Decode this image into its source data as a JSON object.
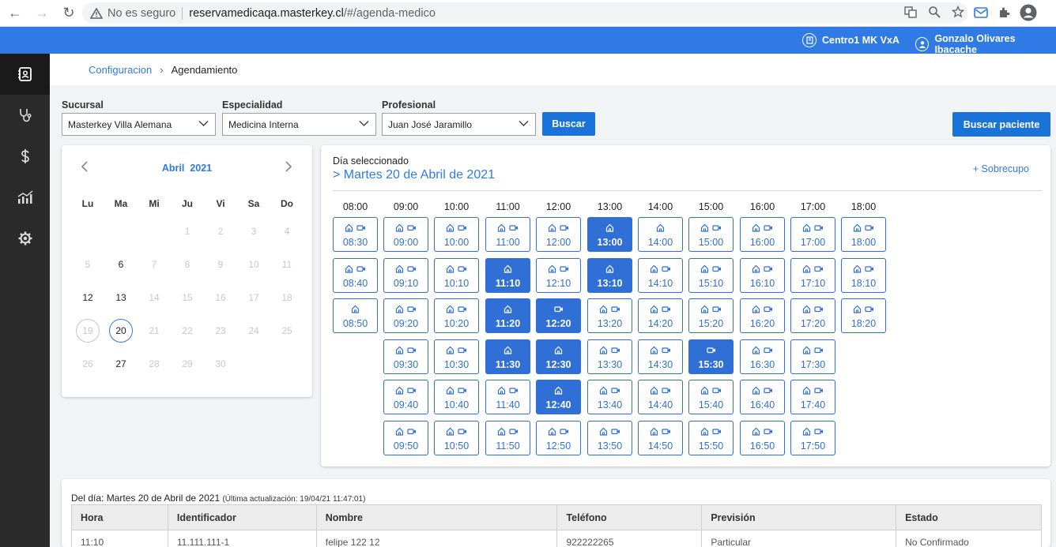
{
  "browser": {
    "insecure_label": "No es seguro",
    "url_host": "reservamedicaqa.masterkey.cl",
    "url_path": "/#/agenda-medico"
  },
  "header": {
    "center": "Centro1 MK VxA",
    "user": "Gonzalo Olivares Ibacache"
  },
  "sidebar": {
    "items": [
      "agenda-icon",
      "stethoscope-icon",
      "dollar-icon",
      "chart-icon",
      "settings-icon"
    ]
  },
  "breadcrumb": {
    "parent": "Configuracion",
    "current": "Agendamiento"
  },
  "filters": {
    "sucursal_label": "Sucursal",
    "sucursal_value": "Masterkey Villa Alemana",
    "especialidad_label": "Especialidad",
    "especialidad_value": "Medicina Interna",
    "profesional_label": "Profesional",
    "profesional_value": "Juan José Jaramillo",
    "search_button": "Buscar",
    "patient_button": "Buscar paciente"
  },
  "calendar": {
    "month": "Abril",
    "year": "2021",
    "weekdays": [
      "Lu",
      "Ma",
      "Mi",
      "Ju",
      "Vi",
      "Sa",
      "Do"
    ],
    "weeks": [
      [
        null,
        null,
        null,
        1,
        2,
        3,
        4
      ],
      [
        5,
        6,
        7,
        8,
        9,
        10,
        11
      ],
      [
        12,
        13,
        14,
        15,
        16,
        17,
        18
      ],
      [
        19,
        20,
        21,
        22,
        23,
        24,
        25
      ],
      [
        26,
        27,
        28,
        29,
        30,
        null,
        null
      ]
    ],
    "enabled_days": [
      6,
      12,
      13,
      20,
      27
    ],
    "today": 19,
    "selected": 20
  },
  "schedule": {
    "selected_label": "Día seleccionado",
    "selected_date": "> Martes 20 de Abril de 2021",
    "sobrecupo": "+ Sobrecupo",
    "hours": [
      "08:00",
      "09:00",
      "10:00",
      "11:00",
      "12:00",
      "13:00",
      "14:00",
      "15:00",
      "16:00",
      "17:00",
      "18:00"
    ],
    "columns": [
      [
        {
          "t": "08:30",
          "m": "hv",
          "s": 0
        },
        {
          "t": "08:40",
          "m": "hv",
          "s": 0
        },
        {
          "t": "08:50",
          "m": "h",
          "s": 0
        }
      ],
      [
        {
          "t": "09:00",
          "m": "hv",
          "s": 0
        },
        {
          "t": "09:10",
          "m": "hv",
          "s": 0
        },
        {
          "t": "09:20",
          "m": "hv",
          "s": 0
        },
        {
          "t": "09:30",
          "m": "hv",
          "s": 0
        },
        {
          "t": "09:40",
          "m": "hv",
          "s": 0
        },
        {
          "t": "09:50",
          "m": "hv",
          "s": 0
        }
      ],
      [
        {
          "t": "10:00",
          "m": "hv",
          "s": 0
        },
        {
          "t": "10:10",
          "m": "hv",
          "s": 0
        },
        {
          "t": "10:20",
          "m": "hv",
          "s": 0
        },
        {
          "t": "10:30",
          "m": "hv",
          "s": 0
        },
        {
          "t": "10:40",
          "m": "hv",
          "s": 0
        },
        {
          "t": "10:50",
          "m": "hv",
          "s": 0
        }
      ],
      [
        {
          "t": "11:00",
          "m": "hv",
          "s": 0
        },
        {
          "t": "11:10",
          "m": "h",
          "s": 1
        },
        {
          "t": "11:20",
          "m": "h",
          "s": 1
        },
        {
          "t": "11:30",
          "m": "h",
          "s": 1
        },
        {
          "t": "11:40",
          "m": "hv",
          "s": 0
        },
        {
          "t": "11:50",
          "m": "hv",
          "s": 0
        }
      ],
      [
        {
          "t": "12:00",
          "m": "hv",
          "s": 0
        },
        {
          "t": "12:10",
          "m": "hv",
          "s": 0
        },
        {
          "t": "12:20",
          "m": "v",
          "s": 1
        },
        {
          "t": "12:30",
          "m": "h",
          "s": 1
        },
        {
          "t": "12:40",
          "m": "h",
          "s": 1
        },
        {
          "t": "12:50",
          "m": "hv",
          "s": 0
        }
      ],
      [
        {
          "t": "13:00",
          "m": "h",
          "s": 1
        },
        {
          "t": "13:10",
          "m": "h",
          "s": 1
        },
        {
          "t": "13:20",
          "m": "hv",
          "s": 0
        },
        {
          "t": "13:30",
          "m": "hv",
          "s": 0
        },
        {
          "t": "13:40",
          "m": "hv",
          "s": 0
        },
        {
          "t": "13:50",
          "m": "hv",
          "s": 0
        }
      ],
      [
        {
          "t": "14:00",
          "m": "h",
          "s": 0
        },
        {
          "t": "14:10",
          "m": "hv",
          "s": 0
        },
        {
          "t": "14:20",
          "m": "hv",
          "s": 0
        },
        {
          "t": "14:30",
          "m": "hv",
          "s": 0
        },
        {
          "t": "14:40",
          "m": "hv",
          "s": 0
        },
        {
          "t": "14:50",
          "m": "hv",
          "s": 0
        }
      ],
      [
        {
          "t": "15:00",
          "m": "hv",
          "s": 0
        },
        {
          "t": "15:10",
          "m": "hv",
          "s": 0
        },
        {
          "t": "15:20",
          "m": "hv",
          "s": 0
        },
        {
          "t": "15:30",
          "m": "v",
          "s": 1
        },
        {
          "t": "15:40",
          "m": "hv",
          "s": 0
        },
        {
          "t": "15:50",
          "m": "hv",
          "s": 0
        }
      ],
      [
        {
          "t": "16:00",
          "m": "hv",
          "s": 0
        },
        {
          "t": "16:10",
          "m": "hv",
          "s": 0
        },
        {
          "t": "16:20",
          "m": "hv",
          "s": 0
        },
        {
          "t": "16:30",
          "m": "hv",
          "s": 0
        },
        {
          "t": "16:40",
          "m": "hv",
          "s": 0
        },
        {
          "t": "16:50",
          "m": "hv",
          "s": 0
        }
      ],
      [
        {
          "t": "17:00",
          "m": "hv",
          "s": 0
        },
        {
          "t": "17:10",
          "m": "hv",
          "s": 0
        },
        {
          "t": "17:20",
          "m": "hv",
          "s": 0
        },
        {
          "t": "17:30",
          "m": "hv",
          "s": 0
        },
        {
          "t": "17:40",
          "m": "hv",
          "s": 0
        },
        {
          "t": "17:50",
          "m": "hv",
          "s": 0
        }
      ],
      [
        {
          "t": "18:00",
          "m": "hv",
          "s": 0
        },
        {
          "t": "18:10",
          "m": "hv",
          "s": 0
        },
        {
          "t": "18:20",
          "m": "hv",
          "s": 0
        }
      ]
    ]
  },
  "day_table": {
    "title": "Del día: Martes 20 de Abril de 2021",
    "updated": "(Última actualización: 19/04/21 11:47:01)",
    "headers": [
      "Hora",
      "Identificador",
      "Nombre",
      "Teléfono",
      "Previsión",
      "Estado"
    ],
    "rows": [
      [
        "11:10",
        "11.111.111-1",
        "felipe 122 12",
        "922222265",
        "Particular",
        "No Confirmado"
      ]
    ]
  }
}
